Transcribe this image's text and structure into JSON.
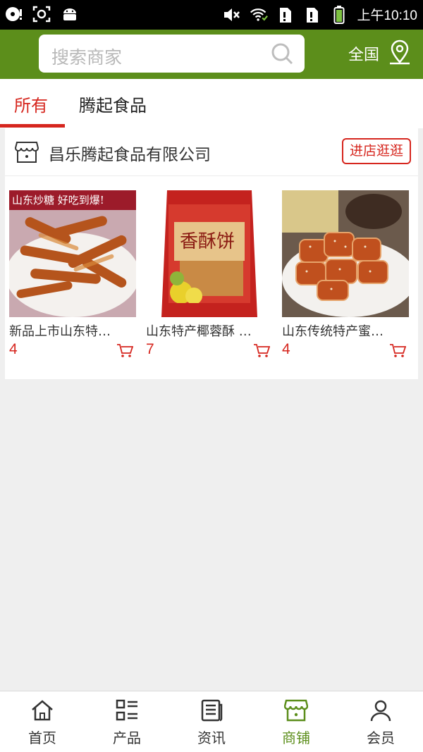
{
  "status_bar": {
    "time": "上午10:10"
  },
  "header": {
    "search_placeholder": "搜索商家",
    "region": "全国"
  },
  "tabs": [
    {
      "label": "所有",
      "active": true
    },
    {
      "label": "腾起食品",
      "active": false
    }
  ],
  "shop": {
    "name": "昌乐腾起食品有限公司",
    "visit_label": "进店逛逛",
    "products": [
      {
        "title": "新品上市山东特…",
        "price": "4",
        "banner": "山东炒糖 好吃到爆!"
      },
      {
        "title": "山东特产椰蓉酥 …",
        "price": "7",
        "package_text": "香酥饼"
      },
      {
        "title": "山东传统特产蜜…",
        "price": "4"
      }
    ]
  },
  "bottom_nav": [
    {
      "label": "首页",
      "icon": "home-icon",
      "active": false
    },
    {
      "label": "产品",
      "icon": "grid-list-icon",
      "active": false
    },
    {
      "label": "资讯",
      "icon": "news-icon",
      "active": false
    },
    {
      "label": "商铺",
      "icon": "shop-icon",
      "active": true
    },
    {
      "label": "会员",
      "icon": "user-icon",
      "active": false
    }
  ],
  "colors": {
    "brand_green": "#5c8e1b",
    "accent_red": "#d6261e"
  }
}
